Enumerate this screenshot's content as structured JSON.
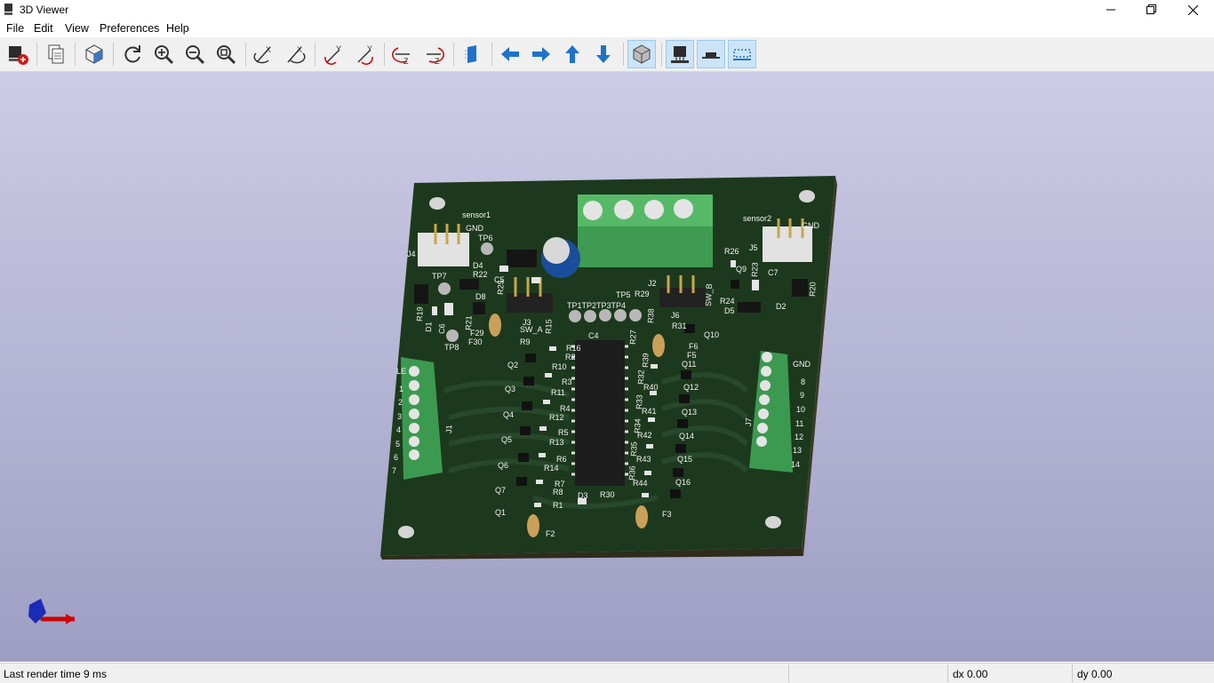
{
  "window": {
    "title": "3D Viewer"
  },
  "menu": [
    "File",
    "Edit",
    "View",
    "Preferences",
    "Help"
  ],
  "toolbar": [
    {
      "id": "raytrace-export",
      "icon": "render-icon"
    },
    {
      "id": "copy",
      "icon": "copy-icon"
    },
    {
      "id": "view-3d",
      "icon": "cube-view-icon"
    },
    {
      "id": "reload",
      "icon": "refresh-icon"
    },
    {
      "id": "zoom-in",
      "icon": "zoom-in-icon"
    },
    {
      "id": "zoom-out",
      "icon": "zoom-out-icon"
    },
    {
      "id": "zoom-fit",
      "icon": "zoom-fit-icon"
    },
    {
      "id": "rotate-x-cw",
      "icon": "rotate-x-cw-icon",
      "label": "X"
    },
    {
      "id": "rotate-x-ccw",
      "icon": "rotate-x-ccw-icon",
      "label": "X"
    },
    {
      "id": "rotate-y-cw",
      "icon": "rotate-y-cw-icon",
      "label": "Y"
    },
    {
      "id": "rotate-y-ccw",
      "icon": "rotate-y-ccw-icon",
      "label": "Y"
    },
    {
      "id": "rotate-z-cw",
      "icon": "rotate-z-cw-icon",
      "label": "Z"
    },
    {
      "id": "rotate-z-ccw",
      "icon": "rotate-z-ccw-icon",
      "label": "Z"
    },
    {
      "id": "flip-board",
      "icon": "flip-board-icon"
    },
    {
      "id": "move-left",
      "icon": "arrow-left-icon"
    },
    {
      "id": "move-right",
      "icon": "arrow-right-icon"
    },
    {
      "id": "move-up",
      "icon": "arrow-up-icon"
    },
    {
      "id": "move-down",
      "icon": "arrow-down-icon"
    },
    {
      "id": "toggle-ortho",
      "icon": "ortho-icon"
    },
    {
      "id": "show-tht",
      "icon": "through-hole-icon"
    },
    {
      "id": "show-smd",
      "icon": "smd-icon"
    },
    {
      "id": "show-virtual",
      "icon": "virtual-icon"
    }
  ],
  "colors": {
    "accent": "#0078d7",
    "pcb": "#1e3b1e",
    "viewport_top": "#cccce6",
    "viewport_bottom": "#9e9ec3"
  },
  "board_labels": {
    "sensor1": "sensor1",
    "sensor2": "sensor2",
    "gnd_left": "GND",
    "gnd_right": "GND",
    "gnd_j7": "GND",
    "tp6": "TP6",
    "tp7": "TP7",
    "tp8": "TP8",
    "tp5": "TP5",
    "tp_row": "TP1TP2TP3TP4",
    "j1": "J1",
    "j2": "J2",
    "j3": "J3",
    "j4": "J4",
    "j5": "J5",
    "j6": "J6",
    "j7": "J7",
    "c4": "C4",
    "c5": "C5",
    "c6": "C6",
    "c7": "C7",
    "d1": "D1",
    "d2": "D2",
    "d3": "D3",
    "d4": "D4",
    "d5": "D5",
    "d8": "D8",
    "f2": "F2",
    "f3": "F3",
    "f5": "F5",
    "f6": "F6",
    "f29": "F29",
    "f30": "F30",
    "sw_a": "SW_A",
    "sw_b": "SW_B",
    "le": "LE",
    "r_left": [
      "R16",
      "R2",
      "R10",
      "R3",
      "R11",
      "R4",
      "R12",
      "R5",
      "R13",
      "R6",
      "R14",
      "R7",
      "R8",
      "R1"
    ],
    "q_left": [
      "Q2",
      "Q3",
      "Q4",
      "Q5",
      "Q6",
      "Q7",
      "Q1"
    ],
    "r_right": [
      "R27",
      "R39",
      "R32",
      "R40",
      "R33",
      "R41",
      "R34",
      "R42",
      "R35",
      "R43",
      "R36",
      "R44"
    ],
    "q_right": [
      "Q10",
      "Q11",
      "Q12",
      "Q13",
      "Q14",
      "Q15",
      "Q16"
    ],
    "r_misc": [
      "R22",
      "R19",
      "R21",
      "R15",
      "R9",
      "R26",
      "R23",
      "R24",
      "R20",
      "R29",
      "R38",
      "R31",
      "R30",
      "R25"
    ],
    "q9": "Q9",
    "j1_pins": [
      "1",
      "2",
      "3",
      "4",
      "5",
      "6",
      "7"
    ],
    "j7_pins": [
      "8",
      "9",
      "10",
      "11",
      "12",
      "13",
      "14"
    ]
  },
  "status": {
    "render_time": "Last render time 9 ms",
    "dx": "dx 0.00",
    "dy": "dy 0.00"
  }
}
